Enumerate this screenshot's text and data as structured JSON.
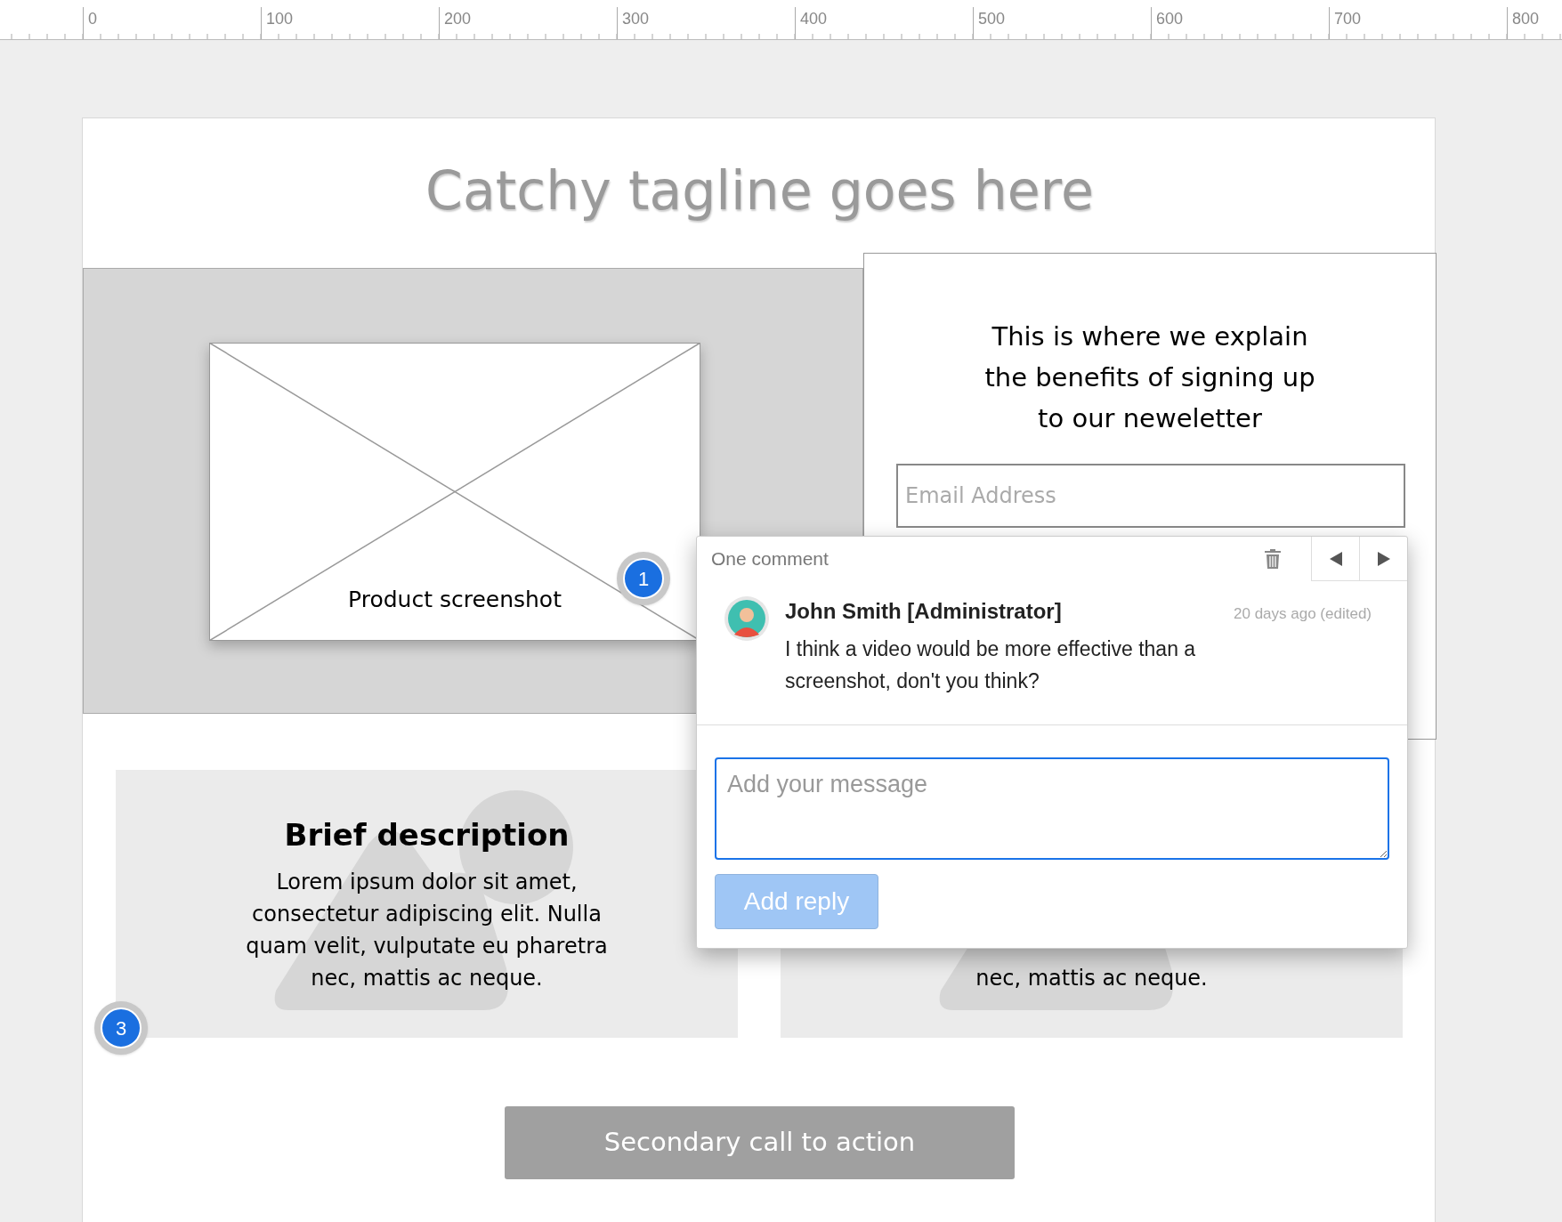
{
  "ruler": {
    "labels": [
      "0",
      "100",
      "200",
      "300",
      "400",
      "500",
      "600",
      "700",
      "800"
    ]
  },
  "canvas": {
    "tagline": "Catchy tagline goes here",
    "hero": {
      "image_label": "Product screenshot"
    },
    "signup": {
      "lines": [
        "This is where we explain",
        "the benefits of signing up",
        "to our neweletter"
      ],
      "email_placeholder": "Email Address"
    },
    "cards": [
      {
        "title": "Brief description",
        "lines": [
          "Lorem ipsum dolor sit amet,",
          "consectetur adipiscing elit. Nulla",
          "quam velit, vulputate eu pharetra",
          "nec, mattis ac neque."
        ]
      },
      {
        "lines": [
          "nec, mattis ac neque."
        ]
      }
    ],
    "secondary_cta": "Secondary call to action",
    "markers": [
      {
        "number": "1"
      },
      {
        "number": "3"
      }
    ]
  },
  "comment_popup": {
    "title": "One comment",
    "author": "John Smith [Administrator]",
    "time": "20 days ago (edited)",
    "text": "I think a video would be more effective than a screenshot, don't you think?",
    "reply_placeholder": "Add your message",
    "reply_button": "Add reply",
    "reply_button_disabled": true
  }
}
